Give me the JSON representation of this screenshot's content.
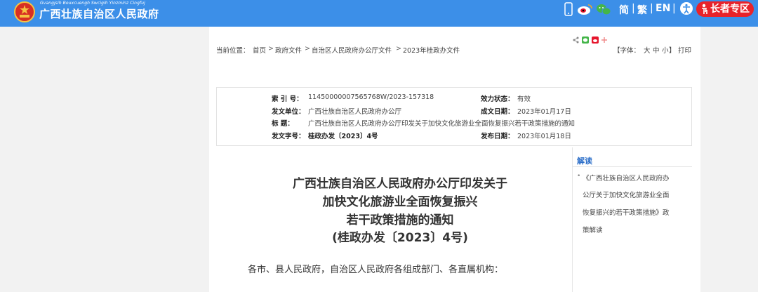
{
  "header": {
    "site_title": "广西壮族自治区人民政府",
    "site_pinyin": "Gvangjsih Bouxcuengh Swcigih Yinzminz Cingfuj",
    "lang_simplified": "简",
    "lang_traditional": "繁",
    "lang_english": "EN",
    "separator": "|",
    "elder_label": "长者专区"
  },
  "breadcrumb": {
    "prefix": "当前位置：",
    "items": [
      "首页",
      "政府文件",
      "自治区人民政府办公厅文件",
      "2023年桂政办文件"
    ],
    "separator": ">"
  },
  "tools": {
    "font_label": "【字体：",
    "font_large": "大",
    "font_medium": "中",
    "font_small": "小",
    "font_end": "】",
    "print": "打印"
  },
  "meta": {
    "index_label": "索  引  号：",
    "index_value": "11450000007565768W/2023-157318",
    "validity_label": "效力状态：",
    "validity_value": "有效",
    "issuer_label": "发文单位：",
    "issuer_value": "广西壮族自治区人民政府办公厅",
    "date_label": "成文日期：",
    "date_value": "2023年01月17日",
    "title_label": "标       题：",
    "title_value": "广西壮族自治区人民政府办公厅印发关于加快文化旅游业全面恢复振兴若干政策措施的通知",
    "docno_label": "发文字号：",
    "docno_value": "桂政办发〔2023〕4号",
    "pubdate_label": "发布日期：",
    "pubdate_value": "2023年01月18日"
  },
  "article": {
    "title_lines": [
      "广西壮族自治区人民政府办公厅印发关于",
      "加快文化旅游业全面恢复振兴",
      "若干政策措施的通知",
      "(桂政办发〔2023〕4号)"
    ],
    "salutation": "各市、县人民政府，自治区人民政府各组成部门、各直属机构："
  },
  "sidebar": {
    "heading": "解读",
    "bullet": "•",
    "link_lines": [
      "《广西壮族自治区人民政府办",
      "公厅关于加快文化旅游业全面",
      "恢复振兴的若干政策措施》政",
      "策解读"
    ]
  },
  "colors": {
    "header_bg": "#3c8fe8",
    "elder_btn": "#e8232a",
    "sidebar_heading": "#2d6fc9"
  },
  "icons": [
    "national-emblem-icon",
    "phone-icon",
    "weibo-icon",
    "wechat-icon",
    "accessibility-icon",
    "elder-icon",
    "share-icon",
    "wechat-share-icon",
    "weibo-share-icon",
    "plus-icon"
  ]
}
